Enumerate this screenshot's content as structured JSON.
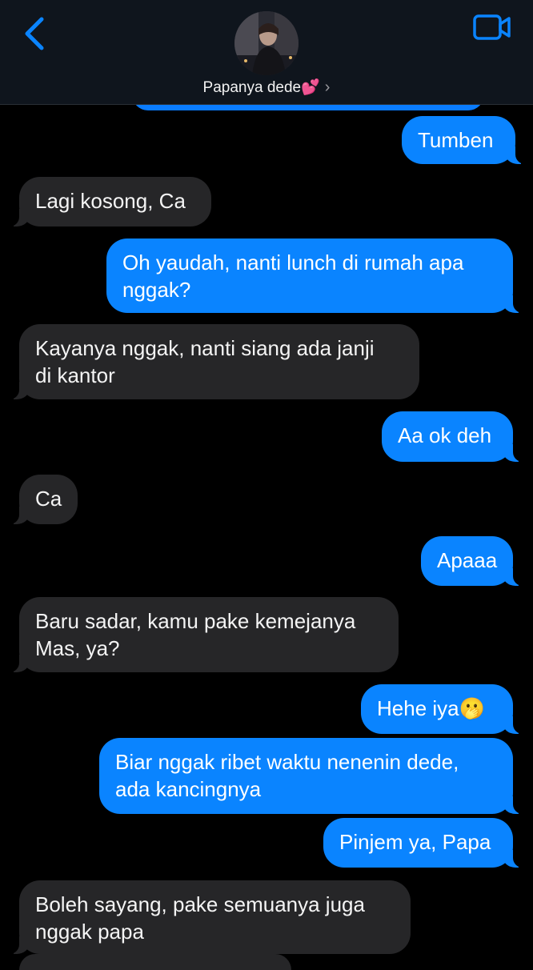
{
  "header": {
    "contact_name": "Papanya dede💕",
    "chevron": "›",
    "back_icon": "chevron-left-icon",
    "video_icon": "video-camera-icon",
    "accent": "#0a84ff"
  },
  "messages": [
    {
      "side": "sent",
      "text": "Tumben"
    },
    {
      "side": "recv",
      "text": "Lagi kosong, Ca"
    },
    {
      "side": "sent",
      "text": "Oh yaudah, nanti lunch di rumah apa\nnggak?"
    },
    {
      "side": "recv",
      "text": "Kayanya nggak, nanti siang ada janji\ndi kantor"
    },
    {
      "side": "sent",
      "text": "Aa ok deh"
    },
    {
      "side": "recv",
      "text": "Ca"
    },
    {
      "side": "sent",
      "text": "Apaaa"
    },
    {
      "side": "recv",
      "text": "Baru sadar, kamu pake kemejanya\nMas, ya?"
    },
    {
      "side": "sent",
      "text": "Hehe iya🫢"
    },
    {
      "side": "sent",
      "text": "Biar nggak ribet waktu nenenin dede,\nada kancingnya"
    },
    {
      "side": "sent",
      "text": "Pinjem ya, Papa"
    },
    {
      "side": "recv",
      "text": "Boleh sayang, pake semuanya juga\nnggak papa"
    }
  ]
}
